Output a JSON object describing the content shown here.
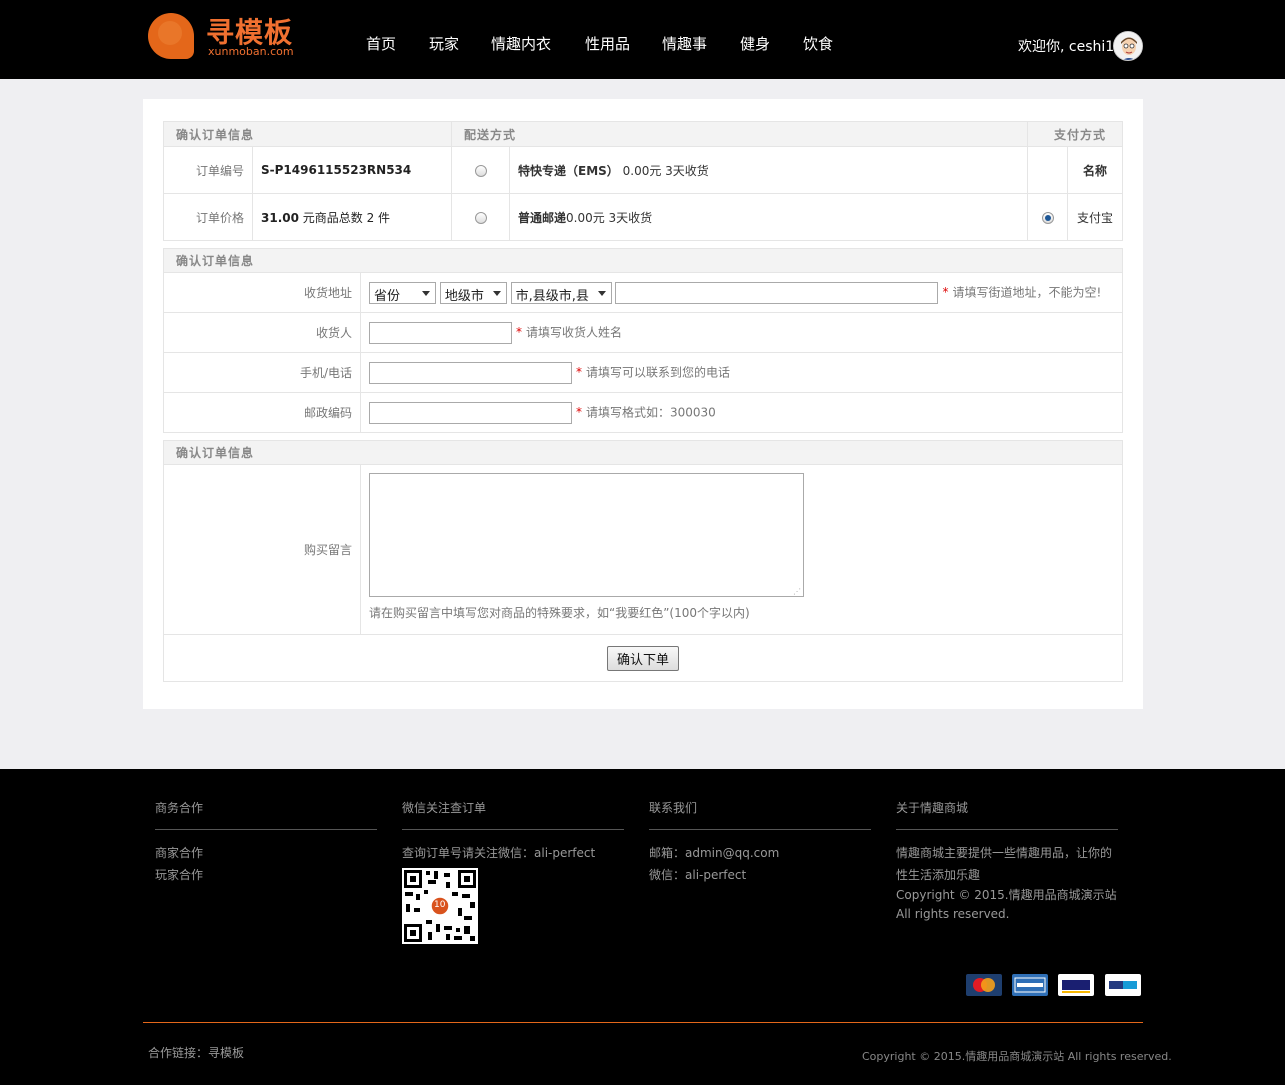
{
  "header": {
    "logo_title": "寻模板",
    "logo_sub": "xunmoban.com",
    "nav": [
      "首页",
      "玩家",
      "情趣内衣",
      "性用品",
      "情趣事",
      "健身",
      "饮食"
    ],
    "welcome": "欢迎你, ceshi1"
  },
  "order": {
    "section1_title": "确认订单信息",
    "delivery_title": "配送方式",
    "payment_title": "支付方式",
    "order_no_label": "订单编号",
    "order_no": "S-P1496115523RN534",
    "order_price_label": "订单价格",
    "order_price_value": "31.00",
    "order_price_rest": " 元商品总数 2 件",
    "delivery": [
      {
        "name": "特快专递（EMS）",
        "detail": "0.00元 3天收货",
        "selected": false
      },
      {
        "name": "普通邮递",
        "detail": "0.00元 3天收货",
        "selected": false
      }
    ],
    "payment_name_header": "名称",
    "payment_option": "支付宝"
  },
  "address": {
    "section_title": "确认订单信息",
    "addr_label": "收货地址",
    "province": "省份",
    "city": "地级市",
    "county": "市,县级市,县",
    "addr_hint": "请填写街道地址，不能为空!",
    "name_label": "收货人",
    "name_hint": "请填写收货人姓名",
    "phone_label": "手机/电话",
    "phone_hint": "请填写可以联系到您的电话",
    "zip_label": "邮政编码",
    "zip_hint": "请填写格式如：300030",
    "required_mark": "*"
  },
  "message": {
    "section_title": "确认订单信息",
    "label": "购买留言",
    "hint": "请在购买留言中填写您对商品的特殊要求，如“我要红色”(100个字以内)",
    "submit": "确认下单"
  },
  "footer": {
    "col1_title": "商务合作",
    "col1_items": [
      "商家合作",
      "玩家合作"
    ],
    "col2_title": "微信关注查订单",
    "col2_text": "查询订单号请关注微信：ali-perfect",
    "col3_title": "联系我们",
    "col3_items": [
      "邮箱：admin@qq.com",
      "微信：ali-perfect"
    ],
    "col4_title": "关于情趣商城",
    "col4_text1": "情趣商城主要提供一些情趣用品，让你的",
    "col4_text2": "性生活添加乐趣",
    "col4_copy1": "Copyright © 2015.情趣用品商城演示站",
    "col4_copy2": "All rights reserved.",
    "payments": [
      "MasterCard",
      "AMERICAN EXPRESS",
      "VISA",
      "PayPal"
    ],
    "links": "合作链接：寻模板",
    "copyright": "Copyright © 2015.情趣用品商城演示站 All rights reserved.",
    "qr_badge": "10"
  }
}
